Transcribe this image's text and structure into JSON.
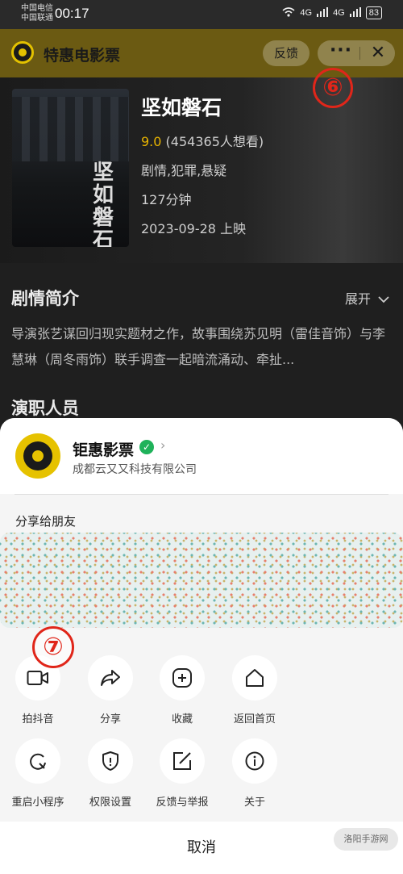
{
  "status_bar": {
    "carrier_1": "中国电信",
    "carrier_2": "中国联通",
    "time": "00:17",
    "network_1": "4G",
    "network_2": "4G",
    "battery": "83"
  },
  "app_bar": {
    "title": "特惠电影票",
    "feedback_label": "反馈",
    "more_icon": "···",
    "close_icon": "✕"
  },
  "movie": {
    "poster_text": "坚如磐石",
    "title": "坚如磐石",
    "score": "9.0",
    "wants": "(454365人想看)",
    "genre": "剧情,犯罪,悬疑",
    "duration": "127分钟",
    "release": "2023-09-28 上映"
  },
  "synopsis": {
    "title": "剧情简介",
    "expand": "展开",
    "text": "导演张艺谋回归现实题材之作，故事围绕苏见明（雷佳音饰）与李慧琳（周冬雨饰）联手调查一起暗流涌动、牵扯..."
  },
  "cast": {
    "title": "演职人员"
  },
  "annotations": {
    "six": "⑥",
    "seven": "⑦"
  },
  "sheet": {
    "brand_name": "钜惠影票",
    "verified": "✓",
    "chevron": "›",
    "company": "成都云又又科技有限公司",
    "share_title": "分享给朋友",
    "actions": [
      {
        "label": "拍抖音",
        "icon": "video-icon"
      },
      {
        "label": "分享",
        "icon": "share-icon"
      },
      {
        "label": "收藏",
        "icon": "add-icon"
      },
      {
        "label": "返回首页",
        "icon": "home-icon"
      },
      {
        "label": "重启小程序",
        "icon": "restart-icon"
      },
      {
        "label": "权限设置",
        "icon": "shield-icon"
      },
      {
        "label": "反馈与举报",
        "icon": "edit-icon"
      },
      {
        "label": "关于",
        "icon": "info-icon"
      }
    ],
    "cancel": "取消",
    "watermark": "洛阳手游网"
  },
  "colors": {
    "accent": "#e3c100",
    "annotation": "#e0261a",
    "verified": "#1fb25a"
  }
}
